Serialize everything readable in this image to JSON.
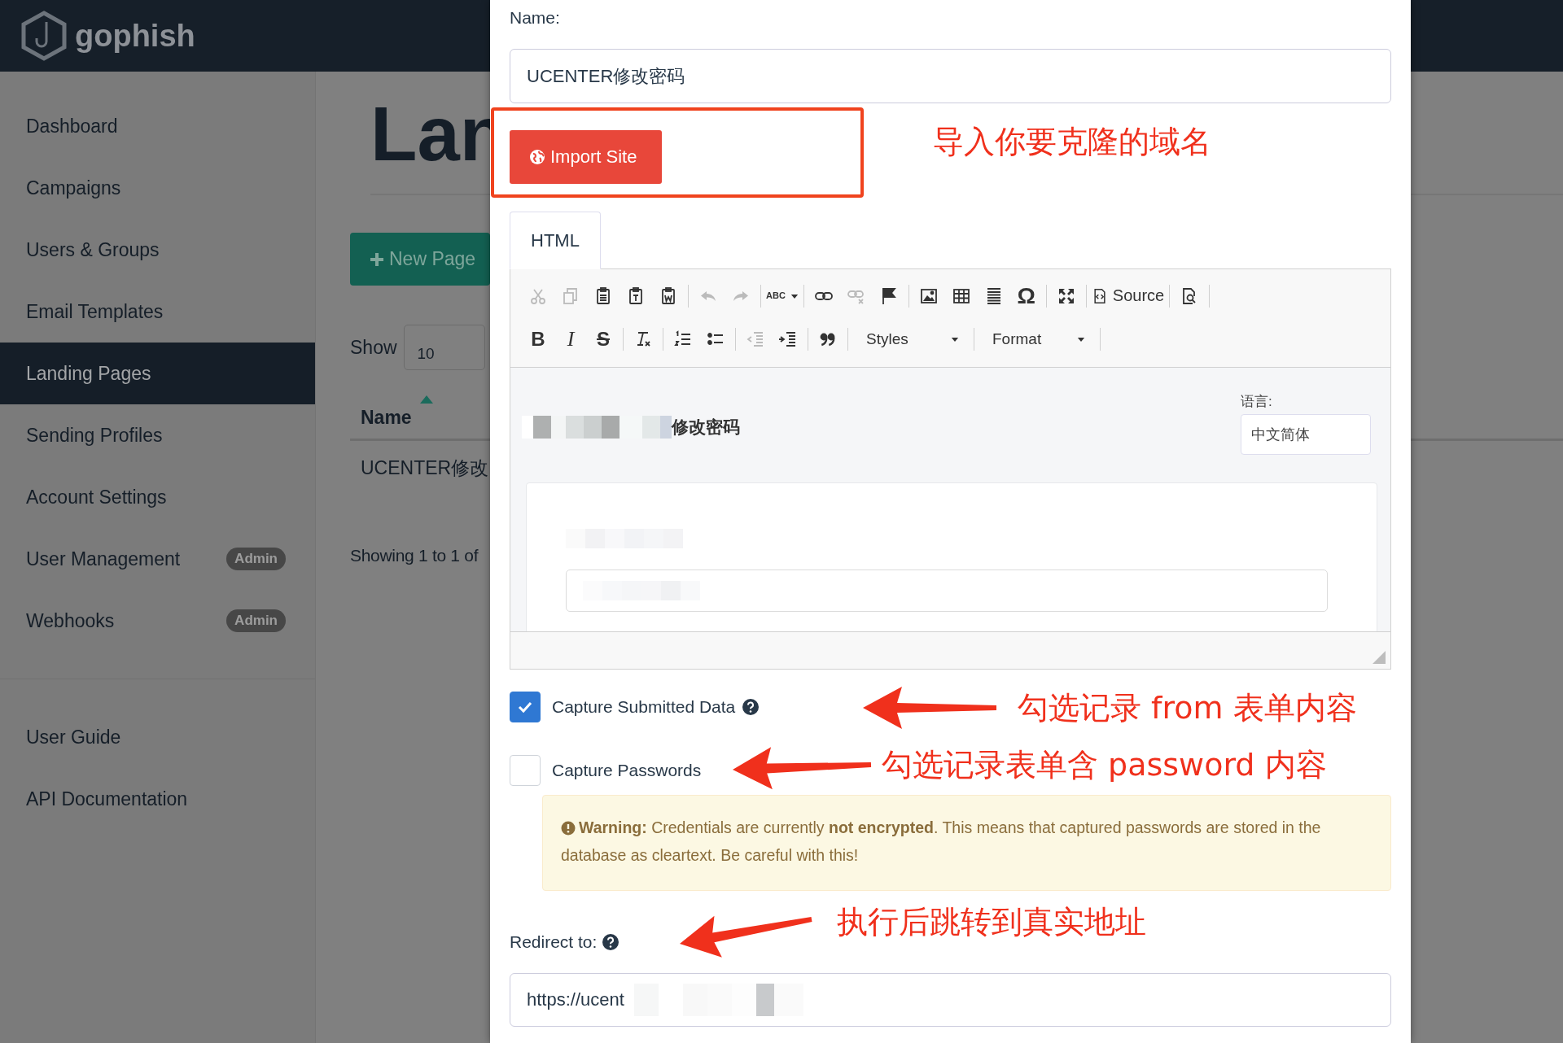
{
  "app": {
    "logo": "gophish"
  },
  "sidebar": {
    "items": [
      {
        "label": "Dashboard",
        "selected": false
      },
      {
        "label": "Campaigns",
        "selected": false
      },
      {
        "label": "Users & Groups",
        "selected": false
      },
      {
        "label": "Email Templates",
        "selected": false
      },
      {
        "label": "Landing Pages",
        "selected": true
      },
      {
        "label": "Sending Profiles",
        "selected": false
      },
      {
        "label": "Account Settings",
        "selected": false
      },
      {
        "label": "User Management",
        "selected": false,
        "badge": "Admin"
      },
      {
        "label": "Webhooks",
        "selected": false,
        "badge": "Admin"
      }
    ],
    "links": [
      {
        "label": "User Guide"
      },
      {
        "label": "API Documentation"
      }
    ]
  },
  "page": {
    "title": "Lan",
    "new_button": "New Page",
    "show_label": "Show",
    "show_value": "10",
    "table": {
      "columns": [
        {
          "label": "Name",
          "sorted": true
        }
      ],
      "rows": [
        [
          "UCENTER修改"
        ]
      ]
    },
    "info": "Showing 1 to 1 of"
  },
  "modal": {
    "name_label": "Name:",
    "name_value": "UCENTER修改密码",
    "import_button": "Import Site",
    "tabs": [
      {
        "label": "HTML",
        "selected": true
      }
    ],
    "toolbar": {
      "rows": [
        {
          "groups": [
            {
              "items": [
                {
                  "kind": "icon",
                  "disabled": true
                },
                {
                  "kind": "icon",
                  "disabled": true
                },
                {
                  "kind": "icon",
                  "disabled": false
                },
                {
                  "kind": "icon",
                  "disabled": false
                },
                {
                  "kind": "icon",
                  "disabled": false
                }
              ]
            },
            {
              "items": [
                {
                  "kind": "icon",
                  "disabled": true
                },
                {
                  "kind": "icon",
                  "disabled": true
                }
              ]
            },
            {
              "items": [
                {
                  "kind": "spell",
                  "text": "ABC",
                  "disabled": false
                }
              ]
            },
            {
              "items": [
                {
                  "kind": "icon",
                  "disabled": false
                },
                {
                  "kind": "icon",
                  "disabled": true
                },
                {
                  "kind": "icon",
                  "disabled": false
                }
              ]
            },
            {
              "items": [
                {
                  "kind": "icon",
                  "disabled": false
                },
                {
                  "kind": "icon",
                  "disabled": false
                },
                {
                  "kind": "icon",
                  "disabled": false
                },
                {
                  "kind": "glyph",
                  "text": "Ω",
                  "disabled": false
                }
              ]
            },
            {
              "items": [
                {
                  "kind": "icon",
                  "disabled": false
                }
              ]
            },
            {
              "items": [
                {
                  "kind": "button",
                  "text": "Source",
                  "disabled": false
                }
              ]
            },
            {
              "items": [
                {
                  "kind": "icon",
                  "disabled": false
                }
              ]
            }
          ]
        },
        {
          "groups": [
            {
              "items": [
                {
                  "kind": "glyph",
                  "text": "B",
                  "disabled": false
                },
                {
                  "kind": "glyph",
                  "text": "I",
                  "disabled": false
                },
                {
                  "kind": "glyph",
                  "text": "S",
                  "disabled": false
                }
              ]
            },
            {
              "items": [
                {
                  "kind": "icon",
                  "disabled": false
                }
              ]
            },
            {
              "items": [
                {
                  "kind": "icon",
                  "disabled": false
                },
                {
                  "kind": "icon",
                  "disabled": false
                }
              ]
            },
            {
              "items": [
                {
                  "kind": "icon",
                  "disabled": true
                },
                {
                  "kind": "icon",
                  "disabled": false
                }
              ]
            },
            {
              "items": [
                {
                  "kind": "icon",
                  "disabled": false
                }
              ]
            },
            {
              "items": [
                {
                  "kind": "dropdown",
                  "text": "Styles",
                  "disabled": false
                }
              ]
            },
            {
              "items": [
                {
                  "kind": "dropdown",
                  "text": "Format",
                  "disabled": false
                }
              ]
            }
          ]
        }
      ]
    },
    "preview": {
      "heading": "修改密码",
      "language_label": "语言:",
      "language_value": "中文简体"
    },
    "options": [
      {
        "label": "Capture Submitted Data",
        "checked": true,
        "help": true
      },
      {
        "label": "Capture Passwords",
        "checked": false,
        "help": false
      }
    ],
    "warning": "**Warning:** Credentials are currently **not encrypted**. This means that captured passwords are stored in the database as cleartext. Be careful with this!",
    "redirect_label": "Redirect to:",
    "redirect_help": true,
    "redirect_value": "https://ucent"
  },
  "annotations": [
    {
      "kind": "box",
      "text": "导入你要克隆的域名"
    },
    {
      "kind": "arrow",
      "text": "勾选记录 from 表单内容"
    },
    {
      "kind": "arrow",
      "text": "勾选记录表单含 password 内容"
    },
    {
      "kind": "arrow",
      "text": "执行后跳转到真实地址"
    }
  ]
}
